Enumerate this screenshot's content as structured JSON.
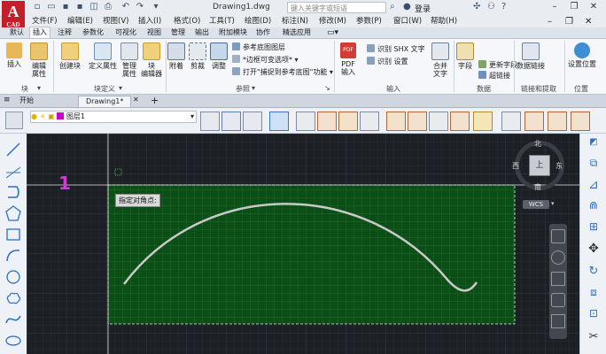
{
  "app": {
    "logo_letter": "A",
    "logo_sub": "CAD",
    "doc_title": "Drawing1.dwg",
    "search_placeholder": "键入关键字或短语",
    "login": "登录"
  },
  "menu": [
    "文件(F)",
    "编辑(E)",
    "视图(V)",
    "插入(I)",
    "格式(O)",
    "工具(T)",
    "绘图(D)",
    "标注(N)",
    "修改(M)",
    "参数(P)",
    "窗口(W)",
    "帮助(H)"
  ],
  "tabs": [
    "默认",
    "插入",
    "注释",
    "参数化",
    "可视化",
    "视图",
    "管理",
    "输出",
    "附加模块",
    "协作",
    "精选应用"
  ],
  "active_tab": "插入",
  "ribbon": {
    "block_panel": {
      "buttons": [
        "插入",
        "编辑\n属性",
        "创建块",
        "定义属性",
        "管理\n属性",
        "块\n编辑器"
      ],
      "label_block": "块",
      "label_define": "块定义"
    },
    "ref_panel": {
      "buttons": [
        "附着",
        "剪裁",
        "调整"
      ],
      "rows": [
        "参考底图图层",
        "*边框可变选项*",
        "打开\"捕捉到参考底图\"功能"
      ],
      "label": "参照"
    },
    "import_panel": {
      "pdf": "PDF\n输入",
      "rows": [
        "识别 SHX 文字",
        "识别 设置"
      ],
      "merge": "合并\n文字",
      "label": "输入"
    },
    "data_panel": {
      "field": "字段",
      "rows": [
        "更新字段",
        "超链接"
      ],
      "label": "数据"
    },
    "link_panel": {
      "button": "数据链接",
      "label": "链接和提取"
    },
    "location_panel": {
      "button": "设置位置",
      "label": "位置"
    }
  },
  "file_tabs": [
    "开始",
    "Drawing1*"
  ],
  "layer": {
    "name": "图层1"
  },
  "canvas": {
    "marker": "1",
    "tooltip": "指定对角点:",
    "compass": {
      "n": "北",
      "s": "南",
      "e": "东",
      "w": "西",
      "center": "上"
    },
    "wcs": "WCS"
  },
  "colors": {
    "selection_fill": "#0c4f16",
    "curve": "#c9c9c9",
    "marker": "#d23ad2",
    "canvas": "#1c1f24"
  }
}
